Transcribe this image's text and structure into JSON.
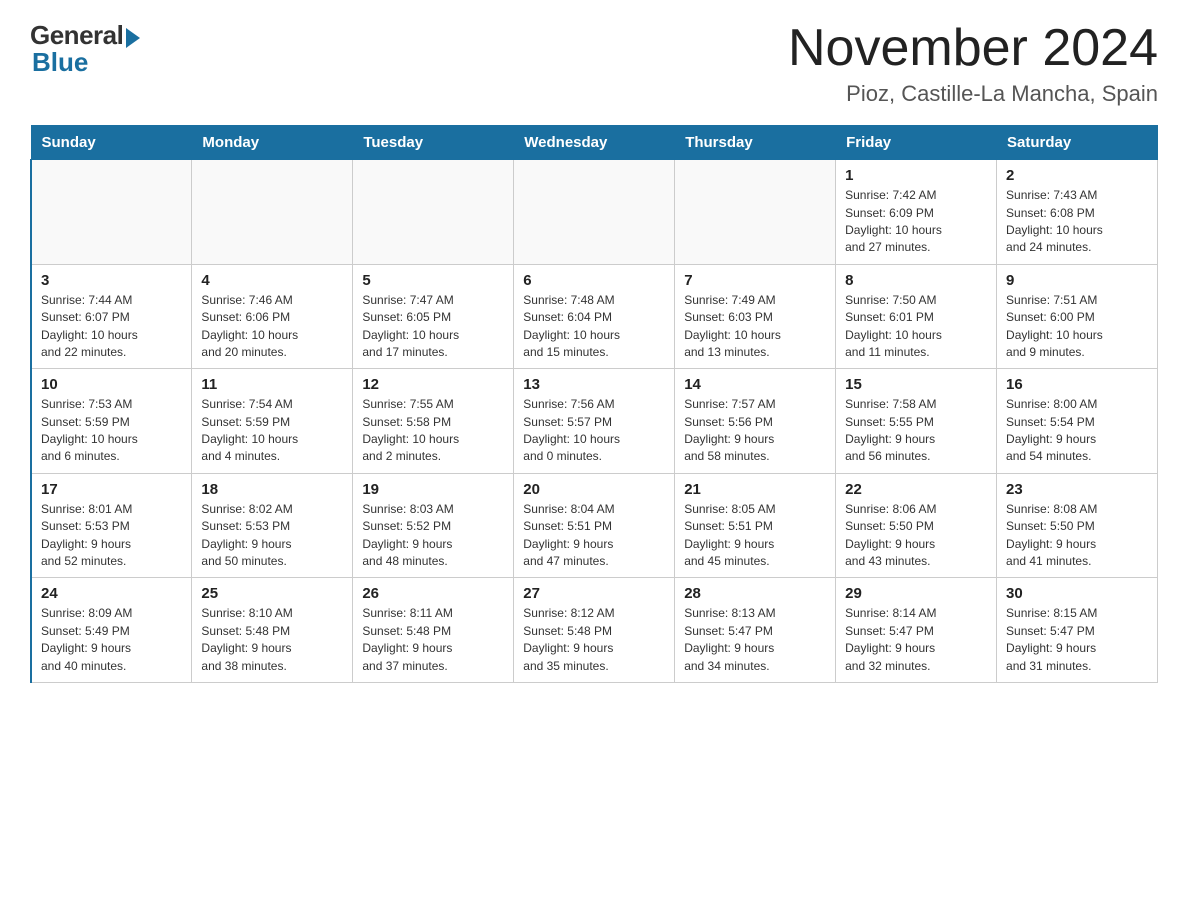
{
  "logo": {
    "general": "General",
    "blue": "Blue"
  },
  "title": "November 2024",
  "location": "Pioz, Castille-La Mancha, Spain",
  "weekdays": [
    "Sunday",
    "Monday",
    "Tuesday",
    "Wednesday",
    "Thursday",
    "Friday",
    "Saturday"
  ],
  "weeks": [
    [
      {
        "day": "",
        "info": ""
      },
      {
        "day": "",
        "info": ""
      },
      {
        "day": "",
        "info": ""
      },
      {
        "day": "",
        "info": ""
      },
      {
        "day": "",
        "info": ""
      },
      {
        "day": "1",
        "info": "Sunrise: 7:42 AM\nSunset: 6:09 PM\nDaylight: 10 hours\nand 27 minutes."
      },
      {
        "day": "2",
        "info": "Sunrise: 7:43 AM\nSunset: 6:08 PM\nDaylight: 10 hours\nand 24 minutes."
      }
    ],
    [
      {
        "day": "3",
        "info": "Sunrise: 7:44 AM\nSunset: 6:07 PM\nDaylight: 10 hours\nand 22 minutes."
      },
      {
        "day": "4",
        "info": "Sunrise: 7:46 AM\nSunset: 6:06 PM\nDaylight: 10 hours\nand 20 minutes."
      },
      {
        "day": "5",
        "info": "Sunrise: 7:47 AM\nSunset: 6:05 PM\nDaylight: 10 hours\nand 17 minutes."
      },
      {
        "day": "6",
        "info": "Sunrise: 7:48 AM\nSunset: 6:04 PM\nDaylight: 10 hours\nand 15 minutes."
      },
      {
        "day": "7",
        "info": "Sunrise: 7:49 AM\nSunset: 6:03 PM\nDaylight: 10 hours\nand 13 minutes."
      },
      {
        "day": "8",
        "info": "Sunrise: 7:50 AM\nSunset: 6:01 PM\nDaylight: 10 hours\nand 11 minutes."
      },
      {
        "day": "9",
        "info": "Sunrise: 7:51 AM\nSunset: 6:00 PM\nDaylight: 10 hours\nand 9 minutes."
      }
    ],
    [
      {
        "day": "10",
        "info": "Sunrise: 7:53 AM\nSunset: 5:59 PM\nDaylight: 10 hours\nand 6 minutes."
      },
      {
        "day": "11",
        "info": "Sunrise: 7:54 AM\nSunset: 5:59 PM\nDaylight: 10 hours\nand 4 minutes."
      },
      {
        "day": "12",
        "info": "Sunrise: 7:55 AM\nSunset: 5:58 PM\nDaylight: 10 hours\nand 2 minutes."
      },
      {
        "day": "13",
        "info": "Sunrise: 7:56 AM\nSunset: 5:57 PM\nDaylight: 10 hours\nand 0 minutes."
      },
      {
        "day": "14",
        "info": "Sunrise: 7:57 AM\nSunset: 5:56 PM\nDaylight: 9 hours\nand 58 minutes."
      },
      {
        "day": "15",
        "info": "Sunrise: 7:58 AM\nSunset: 5:55 PM\nDaylight: 9 hours\nand 56 minutes."
      },
      {
        "day": "16",
        "info": "Sunrise: 8:00 AM\nSunset: 5:54 PM\nDaylight: 9 hours\nand 54 minutes."
      }
    ],
    [
      {
        "day": "17",
        "info": "Sunrise: 8:01 AM\nSunset: 5:53 PM\nDaylight: 9 hours\nand 52 minutes."
      },
      {
        "day": "18",
        "info": "Sunrise: 8:02 AM\nSunset: 5:53 PM\nDaylight: 9 hours\nand 50 minutes."
      },
      {
        "day": "19",
        "info": "Sunrise: 8:03 AM\nSunset: 5:52 PM\nDaylight: 9 hours\nand 48 minutes."
      },
      {
        "day": "20",
        "info": "Sunrise: 8:04 AM\nSunset: 5:51 PM\nDaylight: 9 hours\nand 47 minutes."
      },
      {
        "day": "21",
        "info": "Sunrise: 8:05 AM\nSunset: 5:51 PM\nDaylight: 9 hours\nand 45 minutes."
      },
      {
        "day": "22",
        "info": "Sunrise: 8:06 AM\nSunset: 5:50 PM\nDaylight: 9 hours\nand 43 minutes."
      },
      {
        "day": "23",
        "info": "Sunrise: 8:08 AM\nSunset: 5:50 PM\nDaylight: 9 hours\nand 41 minutes."
      }
    ],
    [
      {
        "day": "24",
        "info": "Sunrise: 8:09 AM\nSunset: 5:49 PM\nDaylight: 9 hours\nand 40 minutes."
      },
      {
        "day": "25",
        "info": "Sunrise: 8:10 AM\nSunset: 5:48 PM\nDaylight: 9 hours\nand 38 minutes."
      },
      {
        "day": "26",
        "info": "Sunrise: 8:11 AM\nSunset: 5:48 PM\nDaylight: 9 hours\nand 37 minutes."
      },
      {
        "day": "27",
        "info": "Sunrise: 8:12 AM\nSunset: 5:48 PM\nDaylight: 9 hours\nand 35 minutes."
      },
      {
        "day": "28",
        "info": "Sunrise: 8:13 AM\nSunset: 5:47 PM\nDaylight: 9 hours\nand 34 minutes."
      },
      {
        "day": "29",
        "info": "Sunrise: 8:14 AM\nSunset: 5:47 PM\nDaylight: 9 hours\nand 32 minutes."
      },
      {
        "day": "30",
        "info": "Sunrise: 8:15 AM\nSunset: 5:47 PM\nDaylight: 9 hours\nand 31 minutes."
      }
    ]
  ]
}
